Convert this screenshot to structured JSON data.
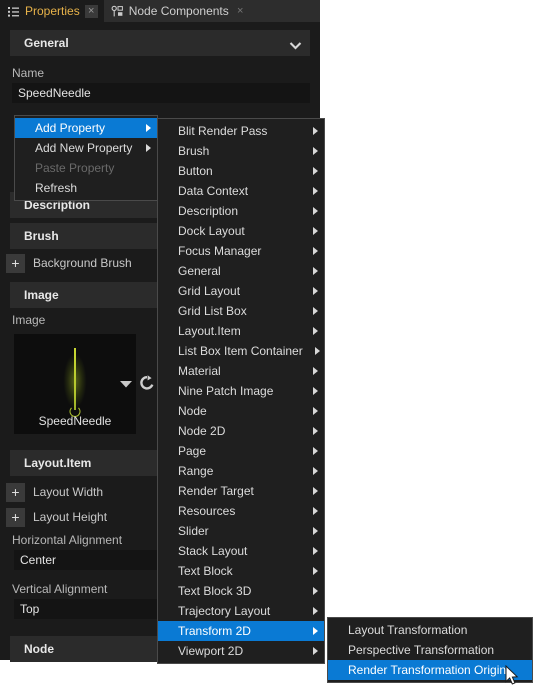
{
  "tabs": [
    {
      "label": "Properties",
      "icon": "list-icon",
      "active": true,
      "close": "×"
    },
    {
      "label": "Node Components",
      "icon": "node-components-icon",
      "active": false,
      "close": "×"
    }
  ],
  "panel": {
    "sections": {
      "general": "General",
      "description": "Description",
      "brush": "Brush",
      "image": "Image",
      "layout_item": "Layout.Item",
      "node": "Node"
    },
    "name_label": "Name",
    "name_value": "SpeedNeedle",
    "background_brush_label": "Background Brush",
    "image_label": "Image",
    "image_preview_caption": "SpeedNeedle",
    "layout_width_label": "Layout Width",
    "layout_height_label": "Layout Height",
    "horizontal_alignment_label": "Horizontal Alignment",
    "horizontal_alignment_value": "Center",
    "vertical_alignment_label": "Vertical Alignment",
    "vertical_alignment_value": "Top",
    "plus_glyph": "+"
  },
  "menu1": {
    "items": [
      {
        "label": "Add Property",
        "submenu": true,
        "selected": true,
        "disabled": false
      },
      {
        "label": "Add New Property",
        "submenu": true,
        "selected": false,
        "disabled": false
      },
      {
        "label": "Paste Property",
        "submenu": false,
        "selected": false,
        "disabled": true
      },
      {
        "label": "Refresh",
        "submenu": false,
        "selected": false,
        "disabled": false
      }
    ]
  },
  "menu2": {
    "items": [
      {
        "label": "Blit Render Pass",
        "submenu": true,
        "selected": false
      },
      {
        "label": "Brush",
        "submenu": true,
        "selected": false
      },
      {
        "label": "Button",
        "submenu": true,
        "selected": false
      },
      {
        "label": "Data Context",
        "submenu": true,
        "selected": false
      },
      {
        "label": "Description",
        "submenu": true,
        "selected": false
      },
      {
        "label": "Dock Layout",
        "submenu": true,
        "selected": false
      },
      {
        "label": "Focus Manager",
        "submenu": true,
        "selected": false
      },
      {
        "label": "General",
        "submenu": true,
        "selected": false
      },
      {
        "label": "Grid Layout",
        "submenu": true,
        "selected": false
      },
      {
        "label": "Grid List Box",
        "submenu": true,
        "selected": false
      },
      {
        "label": "Layout.Item",
        "submenu": true,
        "selected": false
      },
      {
        "label": "List Box Item Container",
        "submenu": true,
        "selected": false
      },
      {
        "label": "Material",
        "submenu": true,
        "selected": false
      },
      {
        "label": "Nine Patch Image",
        "submenu": true,
        "selected": false
      },
      {
        "label": "Node",
        "submenu": true,
        "selected": false
      },
      {
        "label": "Node 2D",
        "submenu": true,
        "selected": false
      },
      {
        "label": "Page",
        "submenu": true,
        "selected": false
      },
      {
        "label": "Range",
        "submenu": true,
        "selected": false
      },
      {
        "label": "Render Target",
        "submenu": true,
        "selected": false
      },
      {
        "label": "Resources",
        "submenu": true,
        "selected": false
      },
      {
        "label": "Slider",
        "submenu": true,
        "selected": false
      },
      {
        "label": "Stack Layout",
        "submenu": true,
        "selected": false
      },
      {
        "label": "Text Block",
        "submenu": true,
        "selected": false
      },
      {
        "label": "Text Block 3D",
        "submenu": true,
        "selected": false
      },
      {
        "label": "Trajectory Layout",
        "submenu": true,
        "selected": false
      },
      {
        "label": "Transform 2D",
        "submenu": true,
        "selected": true
      },
      {
        "label": "Viewport 2D",
        "submenu": true,
        "selected": false
      }
    ]
  },
  "menu3": {
    "items": [
      {
        "label": "Layout Transformation",
        "submenu": false,
        "selected": false
      },
      {
        "label": "Perspective Transformation",
        "submenu": false,
        "selected": false
      },
      {
        "label": "Render Transformation Origin",
        "submenu": false,
        "selected": true
      }
    ]
  },
  "colors": {
    "accent_selection": "#0a7ad4",
    "tab_active_text": "#e8b34a",
    "panel_bg": "#1b1b1b",
    "menu_bg": "#1f1f1f",
    "needle_green": "#c8d732"
  }
}
